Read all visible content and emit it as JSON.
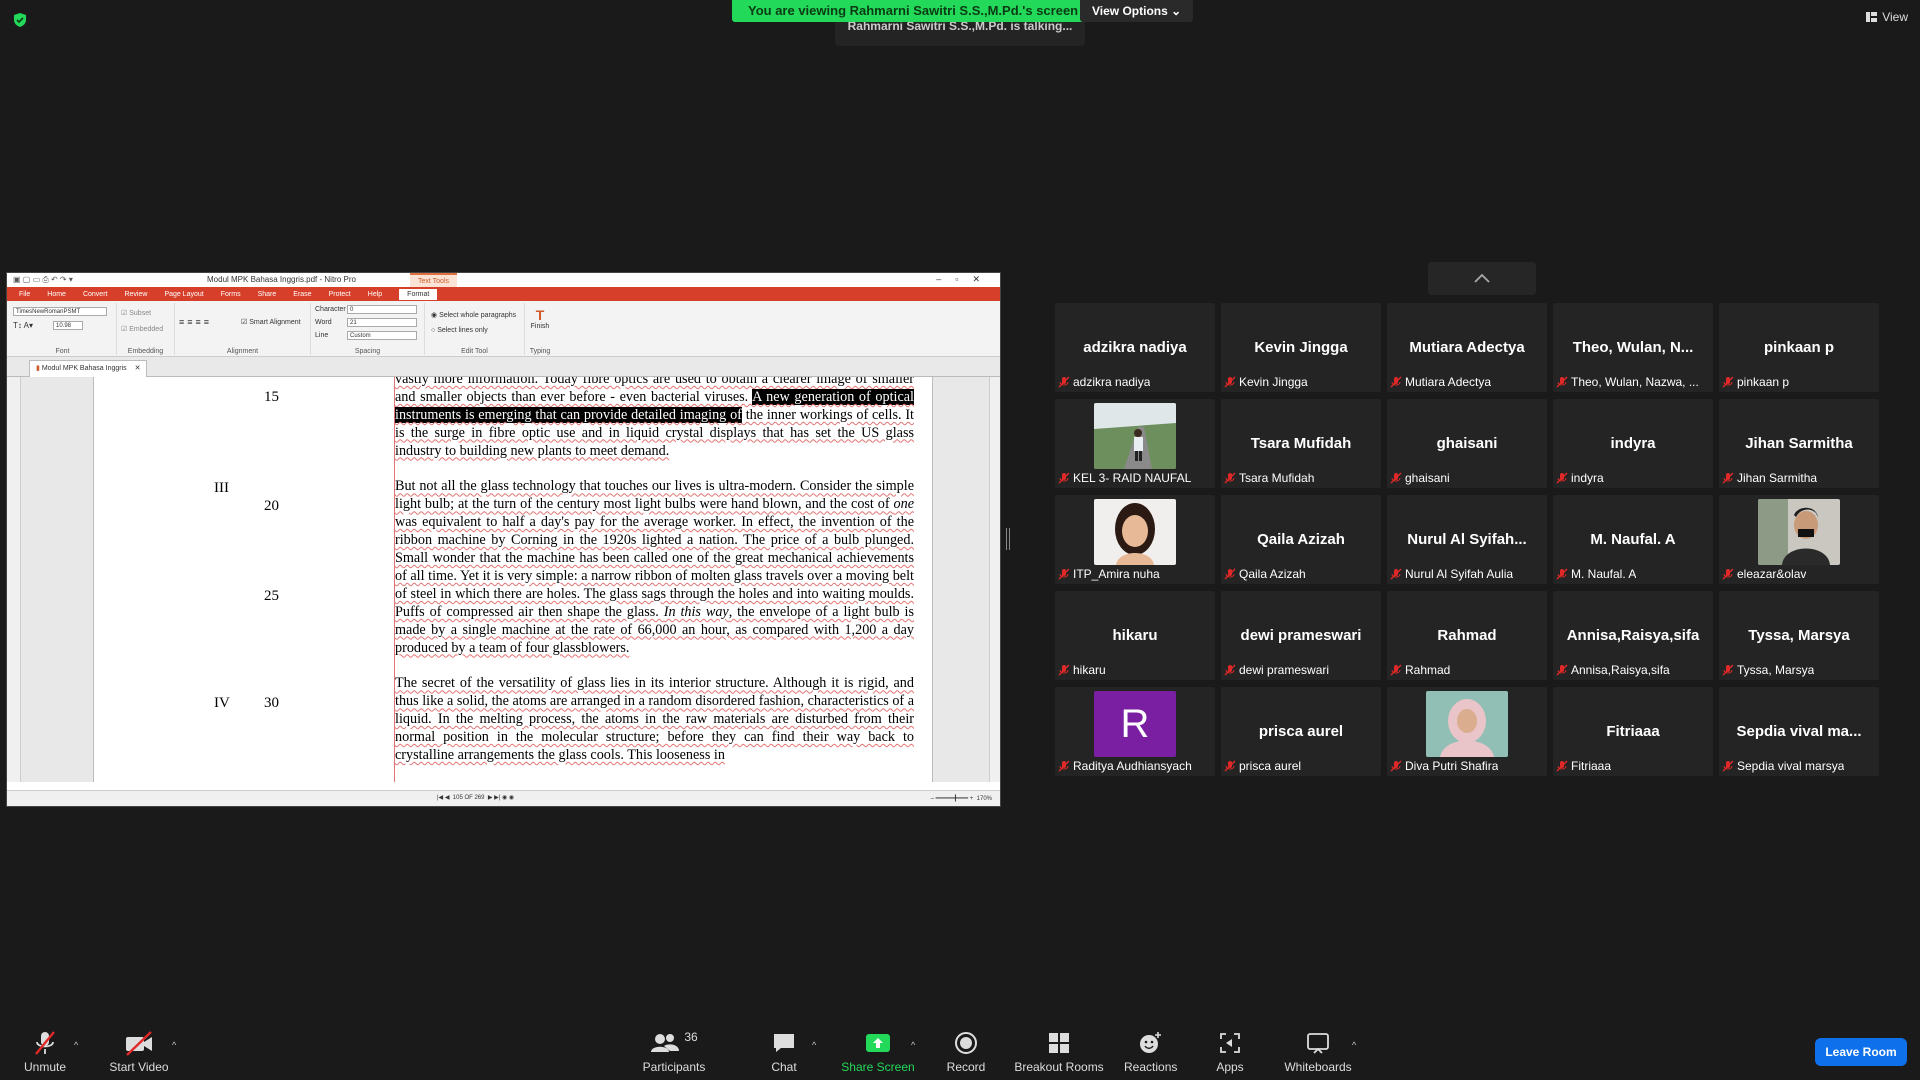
{
  "banner": {
    "viewing": "You are viewing Rahmarni Sawitri S.S.,M.Pd.'s screen",
    "view_options": "View Options",
    "talking": "Rahmarni Sawitri S.S.,M.Pd. is talking...",
    "view": "View"
  },
  "nitro": {
    "title": "Modul MPK Bahasa Inggris.pdf - Nitro Pro",
    "text_tools_tab": "Text Tools",
    "menu": [
      "File",
      "Home",
      "Convert",
      "Review",
      "Page Layout",
      "Forms",
      "Share",
      "Erase",
      "Protect",
      "Help",
      "Format"
    ],
    "ribbon": {
      "font_name": "TimesNewRomanPSMT",
      "font_size": "10.98",
      "font_group": "Font",
      "subset": "Subset",
      "embedded": "Embedded",
      "embedding_group": "Embedding",
      "smart_alignment": "Smart Alignment",
      "alignment_group": "Alignment",
      "character_label": "Character",
      "character_value": "0",
      "word_label": "Word",
      "word_value": "21",
      "line_label": "Line",
      "line_value": "Custom",
      "spacing_group": "Spacing",
      "select_whole": "Select whole paragraphs",
      "select_lines": "Select lines only",
      "edit_tool_group": "Edit Tool",
      "finish": "Finish",
      "typing_group": "Typing"
    },
    "doc_tab": "Modul MPK Bahasa Inggris",
    "page_indicator": "105 OF 269",
    "zoom": "170%"
  },
  "document": {
    "line_numbers": [
      "15",
      "20",
      "25",
      "30"
    ],
    "section_numbers": [
      "III",
      "IV"
    ],
    "p1_before": "vastly more information.  Today fibre optics are used to obtain a clearer image of smaller and smaller objects than ever before - even bacterial viruses.  ",
    "p1_highlight": "A new generation of optical instruments is emerging that can provide detailed imaging of",
    "p1_after": " the inner workings of cells.  It is the surge in fibre optic use and in liquid crystal displays that has set the US glass industry to building new plants to meet demand.",
    "p2_before": "But not all the glass technology that touches our lives is ultra-modern.  Consider the simple light bulb; at the turn of the century most light bulbs were hand blown, and the cost of ",
    "p2_em": "one",
    "p2_mid": " was equivalent to half a day's pay for the average worker.  In effect, the invention of the ribbon machine by Corning in the 1920s lighted a nation.  The price of a bulb plunged.  Small wonder that the machine has been called one of the great mechanical achievements of all time.  Yet it is very simple: a narrow ribbon of molten glass travels over a moving belt of steel in which there are holes.  The glass sags through the holes and into waiting moulds.  Puffs of compressed air then shape the glass.  ",
    "p2_em2": "In this way",
    "p2_after": ", the envelope of a light bulb is made by a single machine at the rate of 66,000 an hour, as compared with 1,200 a day produced by a team of four glassblowers.",
    "p3": "The secret of the versatility of glass lies in its interior structure.  Although it is rigid, and thus like a solid, the atoms are arranged in a random disordered fashion, characteristics of a liquid.  In the melting process, the atoms in the raw materials are disturbed from their normal position in the molecular structure; before they can find their way back to crystalline arrangements the glass cools.  This looseness in"
  },
  "participants": [
    {
      "big": "adzikra nadiya",
      "label": "adzikra nadiya",
      "avatar": null
    },
    {
      "big": "Kevin Jingga",
      "label": "Kevin Jingga",
      "avatar": null
    },
    {
      "big": "Mutiara Adectya",
      "label": "Mutiara Adectya",
      "avatar": null
    },
    {
      "big": "Theo,  Wulan,  N...",
      "label": "Theo, Wulan, Nazwa, ...",
      "avatar": null
    },
    {
      "big": "pinkaan p",
      "label": "pinkaan p",
      "avatar": null
    },
    {
      "big": "",
      "label": "KEL 3- RAID NAUFAL",
      "avatar": "photo-road"
    },
    {
      "big": "Tsara Mufidah",
      "label": "Tsara Mufidah",
      "avatar": null
    },
    {
      "big": "ghaisani",
      "label": "ghaisani",
      "avatar": null
    },
    {
      "big": "indyra",
      "label": "indyra",
      "avatar": null
    },
    {
      "big": "Jihan Sarmitha",
      "label": "Jihan Sarmitha",
      "avatar": null
    },
    {
      "big": "",
      "label": "ITP_Amira nuha",
      "avatar": "photo-girl"
    },
    {
      "big": "Qaila Azizah",
      "label": "Qaila Azizah",
      "avatar": null
    },
    {
      "big": "Nurul Al Syifah...",
      "label": "Nurul Al Syifah Aulia",
      "avatar": null
    },
    {
      "big": "M. Naufal. A",
      "label": "M. Naufal. A",
      "avatar": null
    },
    {
      "big": "",
      "label": "eleazar&olav",
      "avatar": "photo-boy"
    },
    {
      "big": "hikaru",
      "label": "hikaru",
      "avatar": null
    },
    {
      "big": "dewi prameswari",
      "label": "dewi prameswari",
      "avatar": null
    },
    {
      "big": "Rahmad",
      "label": "Rahmad",
      "avatar": null
    },
    {
      "big": "Annisa,Raisya,sifa",
      "label": "Annisa,Raisya,sifa",
      "avatar": null
    },
    {
      "big": "Tyssa,  Marsya",
      "label": "Tyssa, Marsya",
      "avatar": null
    },
    {
      "big": "",
      "label": "Raditya Audhiansyach",
      "avatar": "letter-R"
    },
    {
      "big": "prisca aurel",
      "label": "prisca aurel",
      "avatar": null
    },
    {
      "big": "",
      "label": "Diva Putri Shafira",
      "avatar": "photo-hijab"
    },
    {
      "big": "Fitriaaa",
      "label": "Fitriaaa",
      "avatar": null
    },
    {
      "big": "Sepdia  vival  ma...",
      "label": "Sepdia vival marsya",
      "avatar": null
    }
  ],
  "avatar_letter": "R",
  "colors": {
    "banner_green": "#23d959",
    "leave_blue": "#0e71eb",
    "share_green": "#23d959",
    "mic_off_red": "#e02828",
    "avatar_purple": "#7a1fa2"
  },
  "toolbar": {
    "unmute": "Unmute",
    "start_video": "Start Video",
    "participants": "Participants",
    "participants_count": "36",
    "chat": "Chat",
    "share_screen": "Share Screen",
    "record": "Record",
    "breakout_rooms": "Breakout Rooms",
    "reactions": "Reactions",
    "apps": "Apps",
    "whiteboards": "Whiteboards",
    "leave": "Leave Room"
  }
}
